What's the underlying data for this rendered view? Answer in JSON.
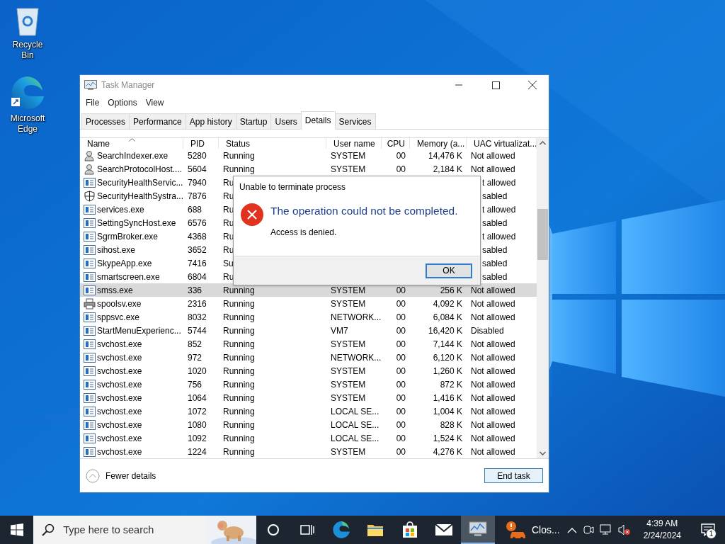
{
  "desktop_icons": [
    {
      "kind": "recycle",
      "label": "Recycle Bin"
    },
    {
      "kind": "edge",
      "label": "Microsoft Edge"
    }
  ],
  "window": {
    "title": "Task Manager",
    "menu": [
      "File",
      "Options",
      "View"
    ],
    "tabs": [
      {
        "label": "Processes",
        "selected": false
      },
      {
        "label": "Performance",
        "selected": false
      },
      {
        "label": "App history",
        "selected": false
      },
      {
        "label": "Startup",
        "selected": false
      },
      {
        "label": "Users",
        "selected": false
      },
      {
        "label": "Details",
        "selected": true
      },
      {
        "label": "Services",
        "selected": false
      }
    ],
    "columns": [
      {
        "label": "Name",
        "sorted": true
      },
      {
        "label": "PID",
        "sorted": false
      },
      {
        "label": "Status",
        "sorted": false
      },
      {
        "label": "User name",
        "sorted": false
      },
      {
        "label": "CPU",
        "sorted": false
      },
      {
        "label": "Memory (a...",
        "sorted": false
      },
      {
        "label": "UAC virtualizat...",
        "sorted": false
      }
    ],
    "rows": [
      {
        "kind": "service",
        "name": "SearchIndexer.exe",
        "pid": "5280",
        "status": "Running",
        "user": "SYSTEM",
        "cpu": "00",
        "memory": "14,476 K",
        "uac": "Not allowed",
        "selected": false
      },
      {
        "kind": "service",
        "name": "SearchProtocolHost....",
        "pid": "5604",
        "status": "Running",
        "user": "SYSTEM",
        "cpu": "00",
        "memory": "2,184 K",
        "uac": "Not allowed",
        "selected": false
      },
      {
        "kind": "app",
        "name": "SecurityHealthServic...",
        "pid": "7940",
        "status": "Ru",
        "uac": "t allowed",
        "selected": false
      },
      {
        "kind": "shield",
        "name": "SecurityHealthSystra...",
        "pid": "7876",
        "status": "Ru",
        "uac": "sabled",
        "selected": false
      },
      {
        "kind": "app",
        "name": "services.exe",
        "pid": "688",
        "status": "Ru",
        "uac": "t allowed",
        "selected": false
      },
      {
        "kind": "app",
        "name": "SettingSyncHost.exe",
        "pid": "6576",
        "status": "Ru",
        "uac": "sabled",
        "selected": false
      },
      {
        "kind": "app",
        "name": "SgrmBroker.exe",
        "pid": "4368",
        "status": "Ru",
        "uac": "t allowed",
        "selected": false
      },
      {
        "kind": "app",
        "name": "sihost.exe",
        "pid": "3652",
        "status": "Ru",
        "uac": "sabled",
        "selected": false
      },
      {
        "kind": "app",
        "name": "SkypeApp.exe",
        "pid": "7416",
        "status": "Su",
        "uac": "sabled",
        "selected": false
      },
      {
        "kind": "app",
        "name": "smartscreen.exe",
        "pid": "6804",
        "status": "Ru",
        "uac": "sabled",
        "selected": false
      },
      {
        "kind": "app",
        "name": "smss.exe",
        "pid": "336",
        "status": "Running",
        "user": "SYSTEM",
        "cpu": "00",
        "memory": "256 K",
        "uac": "Not allowed",
        "selected": true
      },
      {
        "kind": "printer",
        "name": "spoolsv.exe",
        "pid": "2316",
        "status": "Running",
        "user": "SYSTEM",
        "cpu": "00",
        "memory": "4,092 K",
        "uac": "Not allowed",
        "selected": false
      },
      {
        "kind": "app",
        "name": "sppsvc.exe",
        "pid": "8032",
        "status": "Running",
        "user": "NETWORK...",
        "cpu": "00",
        "memory": "6,084 K",
        "uac": "Not allowed",
        "selected": false
      },
      {
        "kind": "app",
        "name": "StartMenuExperienc...",
        "pid": "5744",
        "status": "Running",
        "user": "VM7",
        "cpu": "00",
        "memory": "16,420 K",
        "uac": "Disabled",
        "selected": false
      },
      {
        "kind": "app",
        "name": "svchost.exe",
        "pid": "852",
        "status": "Running",
        "user": "SYSTEM",
        "cpu": "00",
        "memory": "7,144 K",
        "uac": "Not allowed",
        "selected": false
      },
      {
        "kind": "app",
        "name": "svchost.exe",
        "pid": "972",
        "status": "Running",
        "user": "NETWORK...",
        "cpu": "00",
        "memory": "6,120 K",
        "uac": "Not allowed",
        "selected": false
      },
      {
        "kind": "app",
        "name": "svchost.exe",
        "pid": "1020",
        "status": "Running",
        "user": "SYSTEM",
        "cpu": "00",
        "memory": "1,260 K",
        "uac": "Not allowed",
        "selected": false
      },
      {
        "kind": "app",
        "name": "svchost.exe",
        "pid": "756",
        "status": "Running",
        "user": "SYSTEM",
        "cpu": "00",
        "memory": "872 K",
        "uac": "Not allowed",
        "selected": false
      },
      {
        "kind": "app",
        "name": "svchost.exe",
        "pid": "1064",
        "status": "Running",
        "user": "SYSTEM",
        "cpu": "00",
        "memory": "1,416 K",
        "uac": "Not allowed",
        "selected": false
      },
      {
        "kind": "app",
        "name": "svchost.exe",
        "pid": "1072",
        "status": "Running",
        "user": "LOCAL SE...",
        "cpu": "00",
        "memory": "1,004 K",
        "uac": "Not allowed",
        "selected": false
      },
      {
        "kind": "app",
        "name": "svchost.exe",
        "pid": "1080",
        "status": "Running",
        "user": "LOCAL SE...",
        "cpu": "00",
        "memory": "828 K",
        "uac": "Not allowed",
        "selected": false
      },
      {
        "kind": "app",
        "name": "svchost.exe",
        "pid": "1092",
        "status": "Running",
        "user": "LOCAL SE...",
        "cpu": "00",
        "memory": "1,524 K",
        "uac": "Not allowed",
        "selected": false
      },
      {
        "kind": "app",
        "name": "svchost.exe",
        "pid": "1224",
        "status": "Running",
        "user": "SYSTEM",
        "cpu": "00",
        "memory": "4,276 K",
        "uac": "Not allowed",
        "selected": false
      }
    ],
    "fewer_details": "Fewer details",
    "end_task": "End task"
  },
  "dialog": {
    "title": "Unable to terminate process",
    "heading": "The operation could not be completed.",
    "message": "Access is denied.",
    "button": "OK"
  },
  "taskbar": {
    "search_placeholder": "Type here to search",
    "pinned": [
      {
        "kind": "cortana",
        "active": false
      },
      {
        "kind": "taskview",
        "active": false
      },
      {
        "kind": "edge",
        "active": false
      },
      {
        "kind": "folder",
        "active": false
      },
      {
        "kind": "store",
        "active": false
      },
      {
        "kind": "mail",
        "active": false
      },
      {
        "kind": "taskmgr",
        "active": true
      }
    ],
    "app_label": "Clos...",
    "time": "4:39 AM",
    "date": "2/24/2024",
    "notifications": "1"
  }
}
